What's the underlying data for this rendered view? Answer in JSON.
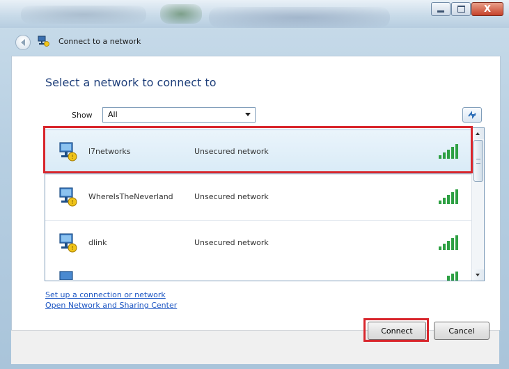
{
  "window": {
    "title": "Connect to a network",
    "caption_buttons": {
      "minimize": "minimize",
      "maximize": "maximize",
      "close": "X"
    }
  },
  "main": {
    "heading": "Select a network to connect to",
    "show_label": "Show",
    "show_value": "All"
  },
  "networks": [
    {
      "name": "l7networks",
      "security": "Unsecured network",
      "selected": true
    },
    {
      "name": "WhereIsTheNeverland",
      "security": "Unsecured network",
      "selected": false
    },
    {
      "name": "dlink",
      "security": "Unsecured network",
      "selected": false
    }
  ],
  "links": {
    "setup": "Set up a connection or network",
    "sharing_center": "Open Network and Sharing Center"
  },
  "buttons": {
    "connect": "Connect",
    "cancel": "Cancel"
  },
  "colors": {
    "accent": "#1f3f7a",
    "highlight": "#d8262c",
    "link": "#1d56c3",
    "signal": "#2ea043"
  },
  "icons": [
    "back-arrow-icon",
    "network-icon",
    "refresh-icon",
    "signal-strength-icon"
  ]
}
